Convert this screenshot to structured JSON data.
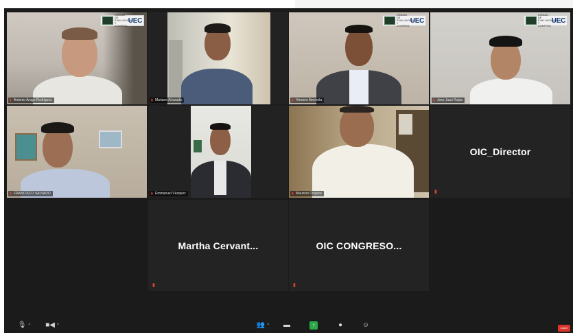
{
  "meeting": {
    "tiles": [
      {
        "name": "Antonio Arago Rodriguez",
        "active": true,
        "mic_muted": true
      },
      {
        "name": "Mariano Alvarado",
        "mic_muted": true
      },
      {
        "name": "Homero Ainchela",
        "mic_muted": true
      },
      {
        "name": "Jose Juan Rojas",
        "mic_muted": true
      },
      {
        "name": "FRANCISCO SALVADO",
        "mic_muted": true
      },
      {
        "name": "Emmanuel Vázquez",
        "mic_muted": true
      },
      {
        "name": "Mauricio Orquiza",
        "mic_muted": true
      },
      {
        "name": "OIC_Director",
        "video_off": true,
        "mic_muted": true
      },
      {
        "name": "Martha  Cervant...",
        "video_off": true,
        "mic_muted": true
      },
      {
        "name": "OIC  CONGRESO...",
        "video_off": true,
        "mic_muted": true
      }
    ],
    "logo": {
      "text": "UEC",
      "small_text": "UNIDAD DE EVALUACIÓN Y CONTROL"
    }
  },
  "toolbar": {
    "leave_label": "Leave"
  },
  "icons": {
    "mic": "microphone-muted-icon",
    "video": "video-camera-icon",
    "participants": "participants-icon",
    "chat": "chat-icon",
    "share": "share-screen-icon",
    "record": "record-icon",
    "reactions": "reactions-icon"
  },
  "colors": {
    "active_speaker_border": "#c6d94a",
    "muted_red": "#e0453a",
    "share_green": "#2aa84a",
    "leave_red": "#d9352b"
  }
}
